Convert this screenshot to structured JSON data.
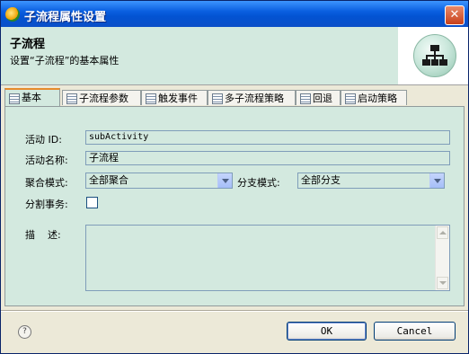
{
  "window": {
    "title": "子流程属性设置",
    "close_glyph": "✕"
  },
  "header": {
    "title": "子流程",
    "description": "设置“子流程”的基本属性"
  },
  "tabs": [
    {
      "label": "基本"
    },
    {
      "label": "子流程参数"
    },
    {
      "label": "触发事件"
    },
    {
      "label": "多子流程策略"
    },
    {
      "label": "回退"
    },
    {
      "label": "启动策略"
    }
  ],
  "form": {
    "activity_id": {
      "label": "活动 ID:",
      "value": "subActivity"
    },
    "activity_name": {
      "label": "活动名称:",
      "value": "子流程"
    },
    "join_mode": {
      "label": "聚合模式:",
      "value": "全部聚合"
    },
    "split_mode": {
      "label": "分支模式:",
      "value": "全部分支"
    },
    "split_transaction": {
      "label": "分割事务:",
      "checked": false
    },
    "description": {
      "label": "描    述:",
      "value": ""
    }
  },
  "footer": {
    "help_glyph": "?",
    "ok_label": "OK",
    "cancel_label": "Cancel"
  }
}
